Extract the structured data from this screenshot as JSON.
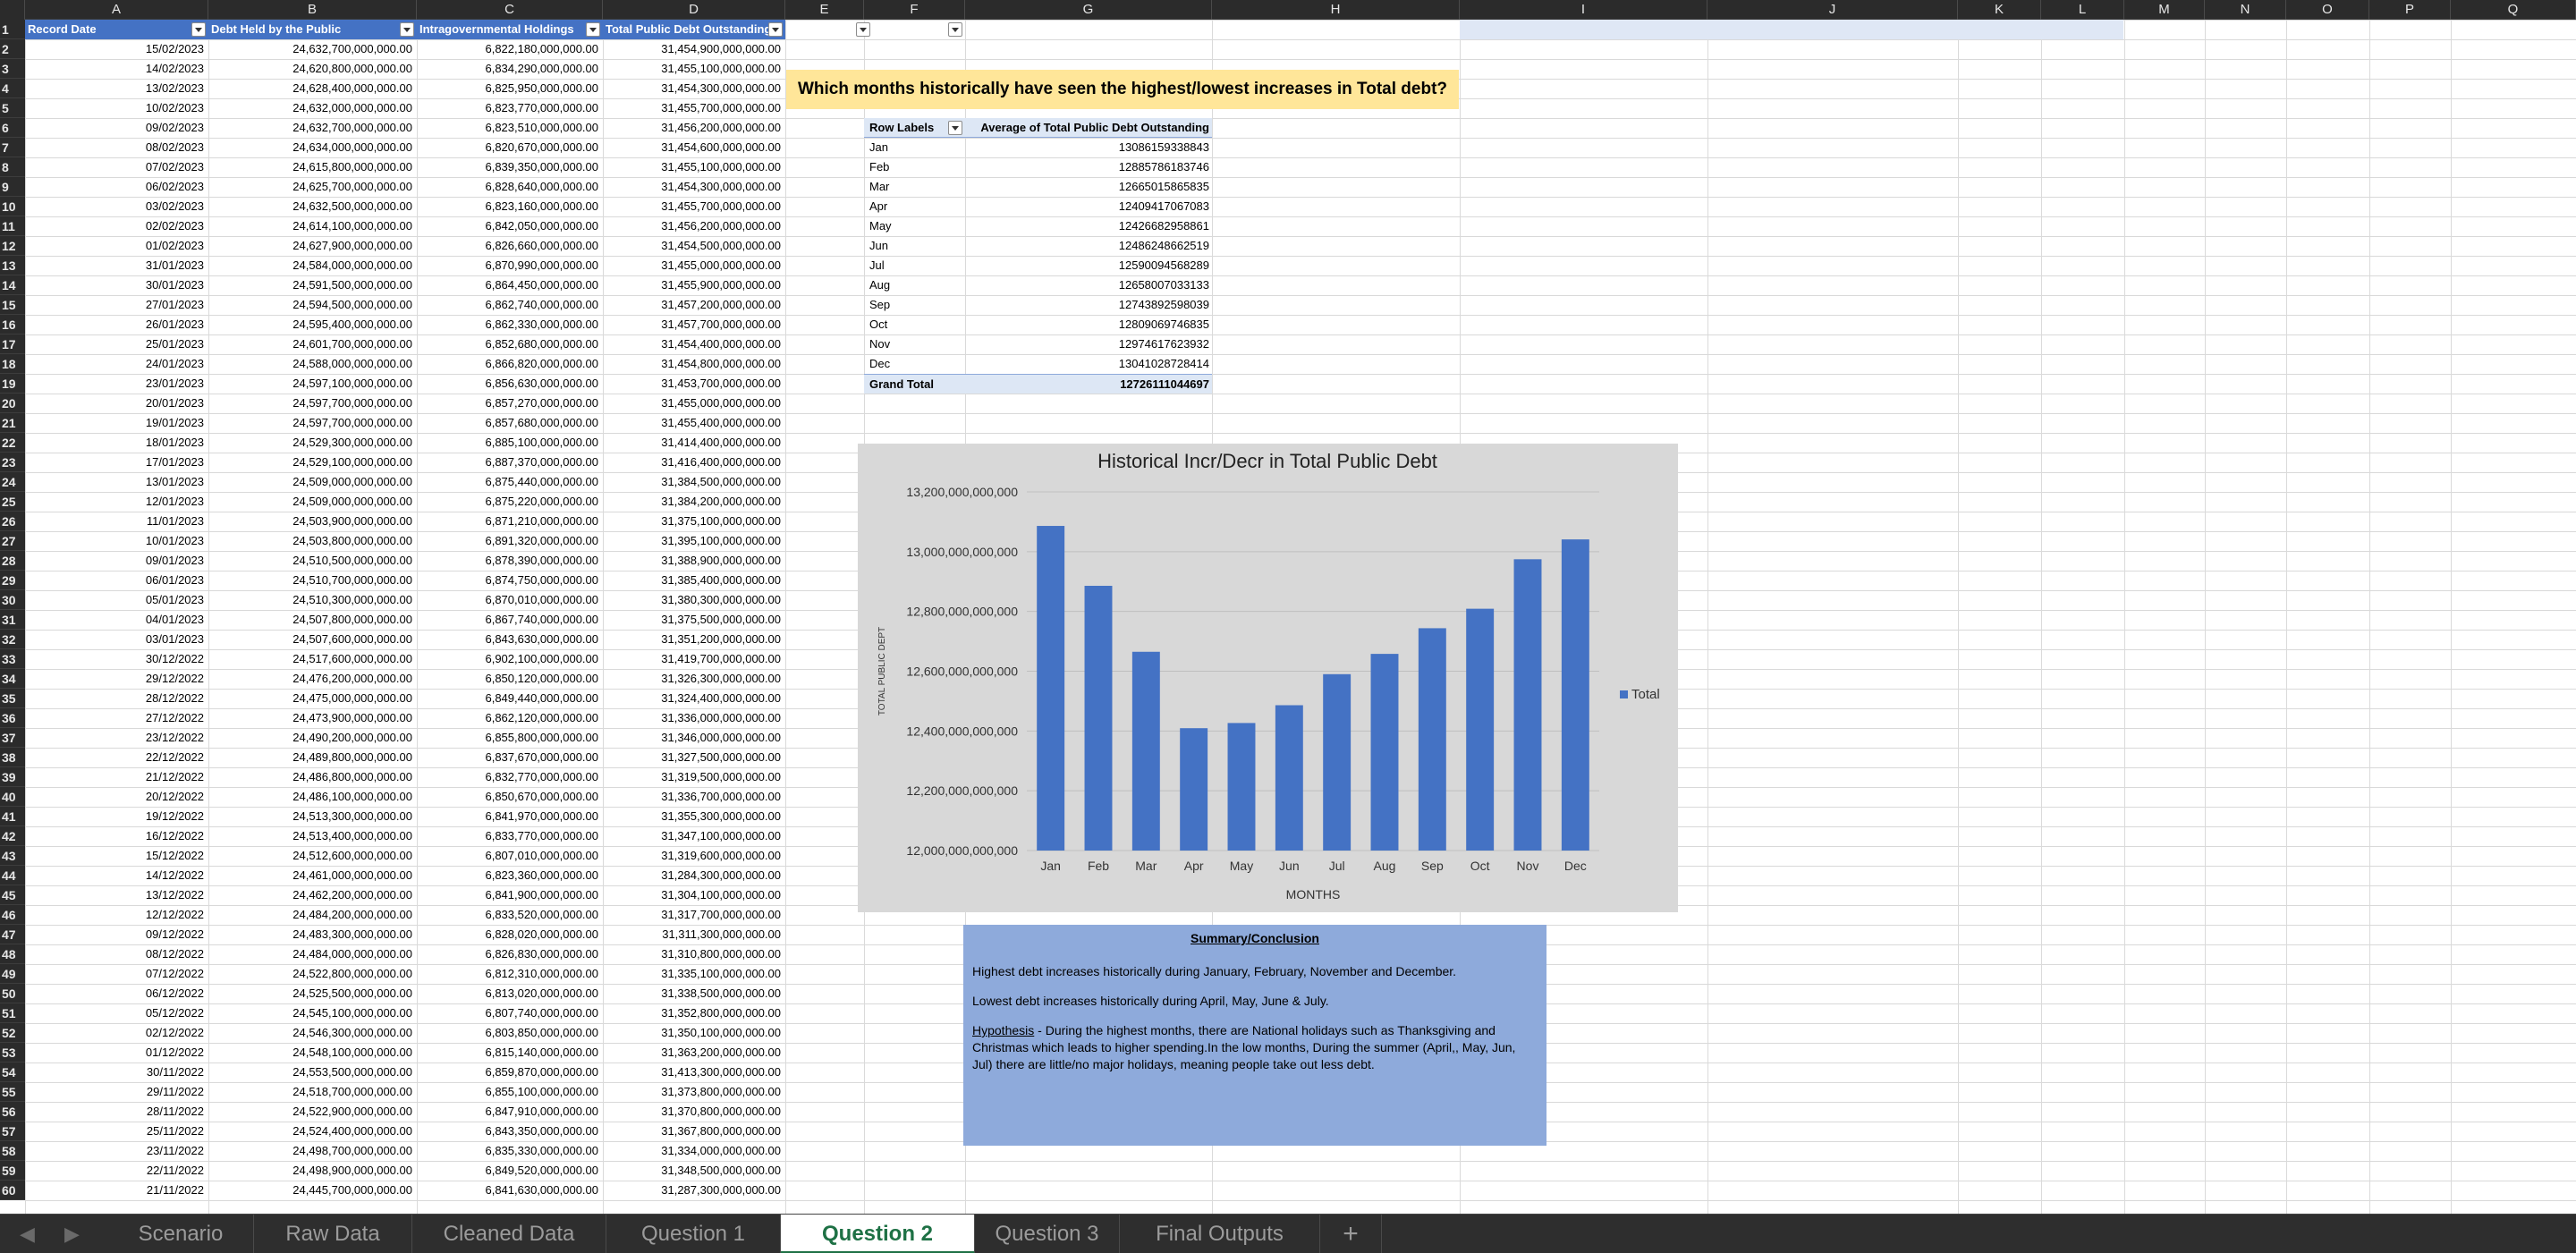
{
  "columns": [
    "A",
    "B",
    "C",
    "D",
    "E",
    "F",
    "G",
    "H",
    "I",
    "J",
    "K",
    "L",
    "M",
    "N",
    "O",
    "P",
    "Q"
  ],
  "table": {
    "headers": [
      "Record Date",
      "Debt Held by the Public",
      "Intragovernmental Holdings",
      "Total Public Debt Outstanding"
    ],
    "rows": [
      [
        "15/02/2023",
        "24,632,700,000,000.00",
        "6,822,180,000,000.00",
        "31,454,900,000,000.00"
      ],
      [
        "14/02/2023",
        "24,620,800,000,000.00",
        "6,834,290,000,000.00",
        "31,455,100,000,000.00"
      ],
      [
        "13/02/2023",
        "24,628,400,000,000.00",
        "6,825,950,000,000.00",
        "31,454,300,000,000.00"
      ],
      [
        "10/02/2023",
        "24,632,000,000,000.00",
        "6,823,770,000,000.00",
        "31,455,700,000,000.00"
      ],
      [
        "09/02/2023",
        "24,632,700,000,000.00",
        "6,823,510,000,000.00",
        "31,456,200,000,000.00"
      ],
      [
        "08/02/2023",
        "24,634,000,000,000.00",
        "6,820,670,000,000.00",
        "31,454,600,000,000.00"
      ],
      [
        "07/02/2023",
        "24,615,800,000,000.00",
        "6,839,350,000,000.00",
        "31,455,100,000,000.00"
      ],
      [
        "06/02/2023",
        "24,625,700,000,000.00",
        "6,828,640,000,000.00",
        "31,454,300,000,000.00"
      ],
      [
        "03/02/2023",
        "24,632,500,000,000.00",
        "6,823,160,000,000.00",
        "31,455,700,000,000.00"
      ],
      [
        "02/02/2023",
        "24,614,100,000,000.00",
        "6,842,050,000,000.00",
        "31,456,200,000,000.00"
      ],
      [
        "01/02/2023",
        "24,627,900,000,000.00",
        "6,826,660,000,000.00",
        "31,454,500,000,000.00"
      ],
      [
        "31/01/2023",
        "24,584,000,000,000.00",
        "6,870,990,000,000.00",
        "31,455,000,000,000.00"
      ],
      [
        "30/01/2023",
        "24,591,500,000,000.00",
        "6,864,450,000,000.00",
        "31,455,900,000,000.00"
      ],
      [
        "27/01/2023",
        "24,594,500,000,000.00",
        "6,862,740,000,000.00",
        "31,457,200,000,000.00"
      ],
      [
        "26/01/2023",
        "24,595,400,000,000.00",
        "6,862,330,000,000.00",
        "31,457,700,000,000.00"
      ],
      [
        "25/01/2023",
        "24,601,700,000,000.00",
        "6,852,680,000,000.00",
        "31,454,400,000,000.00"
      ],
      [
        "24/01/2023",
        "24,588,000,000,000.00",
        "6,866,820,000,000.00",
        "31,454,800,000,000.00"
      ],
      [
        "23/01/2023",
        "24,597,100,000,000.00",
        "6,856,630,000,000.00",
        "31,453,700,000,000.00"
      ],
      [
        "20/01/2023",
        "24,597,700,000,000.00",
        "6,857,270,000,000.00",
        "31,455,000,000,000.00"
      ],
      [
        "19/01/2023",
        "24,597,700,000,000.00",
        "6,857,680,000,000.00",
        "31,455,400,000,000.00"
      ],
      [
        "18/01/2023",
        "24,529,300,000,000.00",
        "6,885,100,000,000.00",
        "31,414,400,000,000.00"
      ],
      [
        "17/01/2023",
        "24,529,100,000,000.00",
        "6,887,370,000,000.00",
        "31,416,400,000,000.00"
      ],
      [
        "13/01/2023",
        "24,509,000,000,000.00",
        "6,875,440,000,000.00",
        "31,384,500,000,000.00"
      ],
      [
        "12/01/2023",
        "24,509,000,000,000.00",
        "6,875,220,000,000.00",
        "31,384,200,000,000.00"
      ],
      [
        "11/01/2023",
        "24,503,900,000,000.00",
        "6,871,210,000,000.00",
        "31,375,100,000,000.00"
      ],
      [
        "10/01/2023",
        "24,503,800,000,000.00",
        "6,891,320,000,000.00",
        "31,395,100,000,000.00"
      ],
      [
        "09/01/2023",
        "24,510,500,000,000.00",
        "6,878,390,000,000.00",
        "31,388,900,000,000.00"
      ],
      [
        "06/01/2023",
        "24,510,700,000,000.00",
        "6,874,750,000,000.00",
        "31,385,400,000,000.00"
      ],
      [
        "05/01/2023",
        "24,510,300,000,000.00",
        "6,870,010,000,000.00",
        "31,380,300,000,000.00"
      ],
      [
        "04/01/2023",
        "24,507,800,000,000.00",
        "6,867,740,000,000.00",
        "31,375,500,000,000.00"
      ],
      [
        "03/01/2023",
        "24,507,600,000,000.00",
        "6,843,630,000,000.00",
        "31,351,200,000,000.00"
      ],
      [
        "30/12/2022",
        "24,517,600,000,000.00",
        "6,902,100,000,000.00",
        "31,419,700,000,000.00"
      ],
      [
        "29/12/2022",
        "24,476,200,000,000.00",
        "6,850,120,000,000.00",
        "31,326,300,000,000.00"
      ],
      [
        "28/12/2022",
        "24,475,000,000,000.00",
        "6,849,440,000,000.00",
        "31,324,400,000,000.00"
      ],
      [
        "27/12/2022",
        "24,473,900,000,000.00",
        "6,862,120,000,000.00",
        "31,336,000,000,000.00"
      ],
      [
        "23/12/2022",
        "24,490,200,000,000.00",
        "6,855,800,000,000.00",
        "31,346,000,000,000.00"
      ],
      [
        "22/12/2022",
        "24,489,800,000,000.00",
        "6,837,670,000,000.00",
        "31,327,500,000,000.00"
      ],
      [
        "21/12/2022",
        "24,486,800,000,000.00",
        "6,832,770,000,000.00",
        "31,319,500,000,000.00"
      ],
      [
        "20/12/2022",
        "24,486,100,000,000.00",
        "6,850,670,000,000.00",
        "31,336,700,000,000.00"
      ],
      [
        "19/12/2022",
        "24,513,300,000,000.00",
        "6,841,970,000,000.00",
        "31,355,300,000,000.00"
      ],
      [
        "16/12/2022",
        "24,513,400,000,000.00",
        "6,833,770,000,000.00",
        "31,347,100,000,000.00"
      ],
      [
        "15/12/2022",
        "24,512,600,000,000.00",
        "6,807,010,000,000.00",
        "31,319,600,000,000.00"
      ],
      [
        "14/12/2022",
        "24,461,000,000,000.00",
        "6,823,360,000,000.00",
        "31,284,300,000,000.00"
      ],
      [
        "13/12/2022",
        "24,462,200,000,000.00",
        "6,841,900,000,000.00",
        "31,304,100,000,000.00"
      ],
      [
        "12/12/2022",
        "24,484,200,000,000.00",
        "6,833,520,000,000.00",
        "31,317,700,000,000.00"
      ],
      [
        "09/12/2022",
        "24,483,300,000,000.00",
        "6,828,020,000,000.00",
        "31,311,300,000,000.00"
      ],
      [
        "08/12/2022",
        "24,484,000,000,000.00",
        "6,826,830,000,000.00",
        "31,310,800,000,000.00"
      ],
      [
        "07/12/2022",
        "24,522,800,000,000.00",
        "6,812,310,000,000.00",
        "31,335,100,000,000.00"
      ],
      [
        "06/12/2022",
        "24,525,500,000,000.00",
        "6,813,020,000,000.00",
        "31,338,500,000,000.00"
      ],
      [
        "05/12/2022",
        "24,545,100,000,000.00",
        "6,807,740,000,000.00",
        "31,352,800,000,000.00"
      ],
      [
        "02/12/2022",
        "24,546,300,000,000.00",
        "6,803,850,000,000.00",
        "31,350,100,000,000.00"
      ],
      [
        "01/12/2022",
        "24,548,100,000,000.00",
        "6,815,140,000,000.00",
        "31,363,200,000,000.00"
      ],
      [
        "30/11/2022",
        "24,553,500,000,000.00",
        "6,859,870,000,000.00",
        "31,413,300,000,000.00"
      ],
      [
        "29/11/2022",
        "24,518,700,000,000.00",
        "6,855,100,000,000.00",
        "31,373,800,000,000.00"
      ],
      [
        "28/11/2022",
        "24,522,900,000,000.00",
        "6,847,910,000,000.00",
        "31,370,800,000,000.00"
      ],
      [
        "25/11/2022",
        "24,524,400,000,000.00",
        "6,843,350,000,000.00",
        "31,367,800,000,000.00"
      ],
      [
        "23/11/2022",
        "24,498,700,000,000.00",
        "6,835,330,000,000.00",
        "31,334,000,000,000.00"
      ],
      [
        "22/11/2022",
        "24,498,900,000,000.00",
        "6,849,520,000,000.00",
        "31,348,500,000,000.00"
      ],
      [
        "21/11/2022",
        "24,445,700,000,000.00",
        "6,841,630,000,000.00",
        "31,287,300,000,000.00"
      ]
    ]
  },
  "question": "Which months historically have seen the highest/lowest increases in Total debt?",
  "pivot": {
    "header_labels": "Row Labels",
    "header_value": "Average of Total Public Debt Outstanding",
    "rows": [
      [
        "Jan",
        "13086159338843"
      ],
      [
        "Feb",
        "12885786183746"
      ],
      [
        "Mar",
        "12665015865835"
      ],
      [
        "Apr",
        "12409417067083"
      ],
      [
        "May",
        "12426682958861"
      ],
      [
        "Jun",
        "12486248662519"
      ],
      [
        "Jul",
        "12590094568289"
      ],
      [
        "Aug",
        "12658007033133"
      ],
      [
        "Sep",
        "12743892598039"
      ],
      [
        "Oct",
        "12809069746835"
      ],
      [
        "Nov",
        "12974617623932"
      ],
      [
        "Dec",
        "13041028728414"
      ]
    ],
    "total_label": "Grand Total",
    "total_value": "12726111044697"
  },
  "chart_data": {
    "type": "bar",
    "title": "Historical Incr/Decr in Total Public Debt",
    "xlabel": "MONTHS",
    "ylabel": "TOTAL PUBLIC DEPT",
    "categories": [
      "Jan",
      "Feb",
      "Mar",
      "Apr",
      "May",
      "Jun",
      "Jul",
      "Aug",
      "Sep",
      "Oct",
      "Nov",
      "Dec"
    ],
    "series": [
      {
        "name": "Total",
        "values": [
          13086159338843,
          12885786183746,
          12665015865835,
          12409417067083,
          12426682958861,
          12486248662519,
          12590094568289,
          12658007033133,
          12743892598039,
          12809069746835,
          12974617623932,
          13041028728414
        ]
      }
    ],
    "ylim": [
      12000000000000,
      13200000000000
    ],
    "yticks": [
      "12,000,000,000,000",
      "12,200,000,000,000",
      "12,400,000,000,000",
      "12,600,000,000,000",
      "12,800,000,000,000",
      "13,000,000,000,000",
      "13,200,000,000,000"
    ],
    "grid": true,
    "legend": "right",
    "bar_color": "#4472c4"
  },
  "summary": {
    "title": "Summary/Conclusion",
    "highest": "Highest debt increases historically during January, February, November and December.",
    "lowest": "Lowest debt increases historically during April, May, June & July.",
    "hypothesis_label": "Hypothesis",
    "hypothesis_text": " - During the highest months, there are National holidays such as Thanksgiving and Christmas which leads to higher spending.In the low months,  During the summer (April,, May, Jun, Jul) there are little/no major holidays, meaning people take out less debt."
  },
  "tabs": [
    "Scenario",
    "Raw Data",
    "Cleaned Data",
    "Question 1",
    "Question 2",
    "Question 3",
    "Final Outputs"
  ],
  "active_tab": "Question 2",
  "add_sheet": "+"
}
